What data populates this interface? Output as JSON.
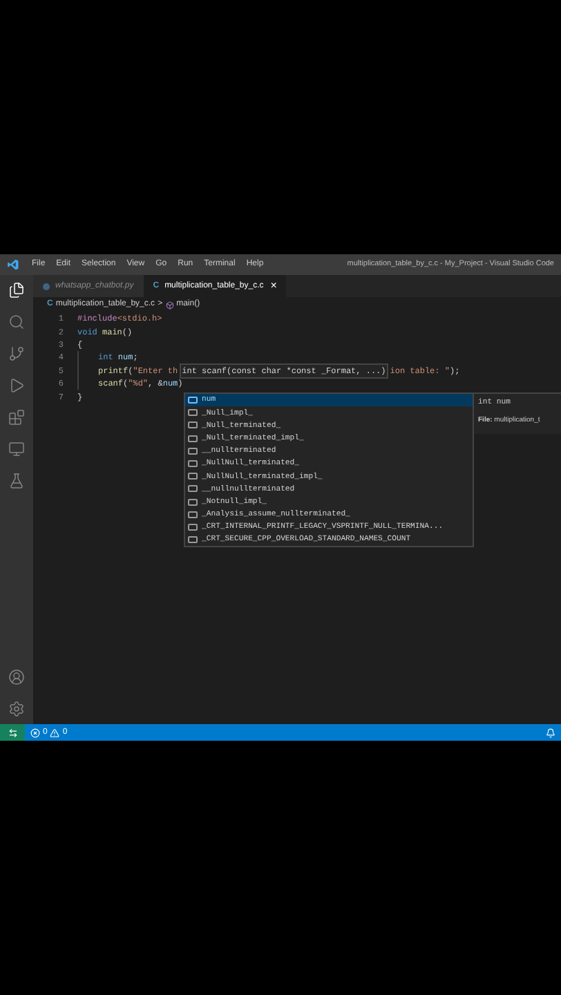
{
  "title_bar": {
    "menu": [
      "File",
      "Edit",
      "Selection",
      "View",
      "Go",
      "Run",
      "Terminal",
      "Help"
    ],
    "title": "multiplication_table_by_c.c - My_Project - Visual Studio Code"
  },
  "tabs": [
    {
      "label": "whatsapp_chatbot.py",
      "kind": "python",
      "selected": false
    },
    {
      "label": "multiplication_table_by_c.c",
      "kind": "c",
      "selected": true,
      "close": "×",
      "icon": "C"
    }
  ],
  "breadcrumb": {
    "icon": "C",
    "file": "multiplication_table_by_c.c",
    "separator": ">",
    "symbol": "main()"
  },
  "lines": [
    {
      "number": "1",
      "indented": false,
      "tokens": [
        {
          "text": "#include",
          "kind": "directive"
        },
        {
          "text": "<stdio.h>",
          "kind": "string"
        }
      ]
    },
    {
      "number": "2",
      "indented": false,
      "tokens": [
        {
          "text": "void",
          "kind": "keyword"
        },
        {
          "text": " main",
          "kind": "function"
        },
        {
          "text": "()",
          "kind": "plain"
        }
      ]
    },
    {
      "number": "3",
      "indented": false,
      "tokens": [
        {
          "text": "{",
          "kind": "plain"
        }
      ]
    },
    {
      "number": "4",
      "indented": true,
      "tokens": [
        {
          "text": "int",
          "kind": "keyword"
        },
        {
          "text": " num",
          "kind": "variable"
        },
        {
          "text": ";",
          "kind": "plain"
        }
      ]
    },
    {
      "number": "5",
      "indented": true,
      "tokens": [
        {
          "text": "printf",
          "kind": "function"
        },
        {
          "text": "(",
          "kind": "plain"
        },
        {
          "text": "\"Enter th",
          "kind": "string"
        },
        {
          "text": "int scanf(const char *const _Format, ...)",
          "kind": "hover"
        },
        {
          "text": "ion table: \"",
          "kind": "string"
        },
        {
          "text": ");",
          "kind": "plain"
        }
      ]
    },
    {
      "number": "6",
      "indented": true,
      "tokens": [
        {
          "text": "scanf",
          "kind": "function"
        },
        {
          "text": "(",
          "kind": "plain"
        },
        {
          "text": "\"%d\"",
          "kind": "string"
        },
        {
          "text": ", &",
          "kind": "plain"
        },
        {
          "text": "num",
          "kind": "variable"
        },
        {
          "text": ")",
          "kind": "plain"
        }
      ]
    },
    {
      "number": "7",
      "indented": false,
      "tokens": [
        {
          "text": "}",
          "kind": "plain"
        }
      ]
    }
  ],
  "suggestions": [
    {
      "label": "num",
      "kind": "variable",
      "selected": true
    },
    {
      "label": "_Null_impl_",
      "kind": "text",
      "selected": false
    },
    {
      "label": "_Null_terminated_",
      "kind": "text",
      "selected": false
    },
    {
      "label": "_Null_terminated_impl_",
      "kind": "text",
      "selected": false
    },
    {
      "label": "__nullterminated",
      "kind": "text",
      "selected": false
    },
    {
      "label": "_NullNull_terminated_",
      "kind": "text",
      "selected": false
    },
    {
      "label": "_NullNull_terminated_impl_",
      "kind": "text",
      "selected": false
    },
    {
      "label": "__nullnullterminated",
      "kind": "text",
      "selected": false
    },
    {
      "label": "_Notnull_impl_",
      "kind": "text",
      "selected": false
    },
    {
      "label": "_Analysis_assume_nullterminated_",
      "kind": "text",
      "selected": false
    },
    {
      "label": "_CRT_INTERNAL_PRINTF_LEGACY_VSPRINTF_NULL_TERMINA...",
      "kind": "text",
      "selected": false
    },
    {
      "label": "_CRT_SECURE_CPP_OVERLOAD_STANDARD_NAMES_COUNT",
      "kind": "text",
      "selected": false
    }
  ],
  "suggestion_details": {
    "signature": "int num",
    "file_label": "File:",
    "file": "multiplication_t"
  },
  "status_bar": {
    "errors": "0",
    "warnings": "0"
  }
}
